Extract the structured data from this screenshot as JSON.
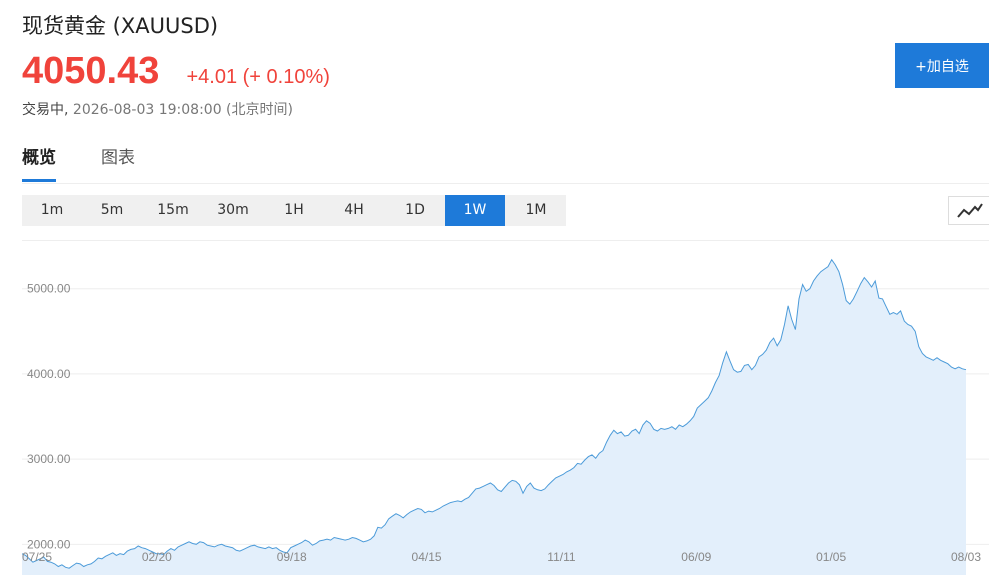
{
  "header": {
    "title": "现货黄金 (XAUUSD)",
    "price": "4050.43",
    "change": "+4.01 (+ 0.10%)",
    "status": "交易中,",
    "timestamp": "2026-08-03 19:08:00 (北京时间)",
    "watch_button": "+加自选"
  },
  "tabs": [
    {
      "label": "概览",
      "active": true
    },
    {
      "label": "图表",
      "active": false
    }
  ],
  "periods": [
    {
      "label": "1m"
    },
    {
      "label": "5m"
    },
    {
      "label": "15m"
    },
    {
      "label": "30m"
    },
    {
      "label": "1H"
    },
    {
      "label": "4H"
    },
    {
      "label": "1D"
    },
    {
      "label": "1W",
      "active": true
    },
    {
      "label": "1M"
    }
  ],
  "chart_type_button": {
    "icon": "line-chart-icon"
  },
  "colors": {
    "accent": "#1e7ad9",
    "up": "#f0433b",
    "line": "#4c9bd9",
    "fill": "#e3effb"
  },
  "chart_data": {
    "type": "area",
    "ylabel": "",
    "xlabel": "",
    "ylim": [
      1640,
      5560
    ],
    "y_ticks": [
      "2000.00",
      "3000.00",
      "4000.00",
      "5000.00"
    ],
    "x_tick_labels": [
      "07/25",
      "02/20",
      "09/18",
      "04/15",
      "11/11",
      "06/09",
      "01/05",
      "08/03"
    ],
    "series": [
      {
        "values": [
          1890,
          1870,
          1830,
          1790,
          1810,
          1830,
          1850,
          1800,
          1790,
          1770,
          1740,
          1760,
          1730,
          1720,
          1750,
          1780,
          1770,
          1740,
          1760,
          1770,
          1800,
          1840,
          1830,
          1860,
          1880,
          1900,
          1870,
          1890,
          1880,
          1920,
          1940,
          1950,
          1980,
          1960,
          1950,
          1930,
          1910,
          1890,
          1890,
          1880,
          1920,
          1950,
          1930,
          1970,
          1990,
          2010,
          2030,
          2010,
          2000,
          2030,
          2020,
          1990,
          1980,
          1970,
          1990,
          2000,
          1980,
          1970,
          1960,
          1930,
          1920,
          1940,
          1960,
          1980,
          1990,
          1970,
          1960,
          1950,
          1970,
          1950,
          1960,
          1930,
          1910,
          1900,
          1960,
          1980,
          2000,
          2020,
          2050,
          2030,
          1990,
          2010,
          2040,
          2050,
          2060,
          2050,
          2080,
          2070,
          2060,
          2050,
          2060,
          2080,
          2070,
          2050,
          2030,
          2040,
          2060,
          2100,
          2200,
          2190,
          2230,
          2300,
          2330,
          2360,
          2340,
          2310,
          2350,
          2380,
          2400,
          2420,
          2410,
          2370,
          2390,
          2380,
          2400,
          2420,
          2450,
          2470,
          2490,
          2500,
          2510,
          2500,
          2530,
          2550,
          2600,
          2650,
          2660,
          2680,
          2700,
          2720,
          2690,
          2640,
          2620,
          2670,
          2720,
          2750,
          2740,
          2700,
          2600,
          2680,
          2720,
          2660,
          2640,
          2630,
          2650,
          2700,
          2740,
          2780,
          2800,
          2820,
          2850,
          2870,
          2900,
          2950,
          2940,
          2990,
          3030,
          3050,
          3010,
          3070,
          3100,
          3200,
          3280,
          3340,
          3300,
          3320,
          3270,
          3280,
          3330,
          3350,
          3300,
          3400,
          3450,
          3420,
          3350,
          3330,
          3360,
          3350,
          3360,
          3380,
          3350,
          3400,
          3380,
          3410,
          3450,
          3500,
          3600,
          3640,
          3680,
          3720,
          3800,
          3900,
          3980,
          4130,
          4260,
          4150,
          4050,
          4020,
          4030,
          4100,
          4110,
          4050,
          4100,
          4200,
          4230,
          4280,
          4370,
          4420,
          4330,
          4400,
          4580,
          4800,
          4640,
          4520,
          4880,
          5050,
          4970,
          5000,
          5090,
          5150,
          5200,
          5230,
          5260,
          5340,
          5280,
          5200,
          5050,
          4860,
          4820,
          4880,
          4970,
          5060,
          5130,
          5080,
          5020,
          5090,
          4890,
          4880,
          4790,
          4700,
          4720,
          4700,
          4740,
          4620,
          4580,
          4560,
          4500,
          4320,
          4240,
          4200,
          4180,
          4160,
          4190,
          4160,
          4140,
          4120,
          4080,
          4060,
          4080,
          4060,
          4050
        ]
      }
    ]
  }
}
